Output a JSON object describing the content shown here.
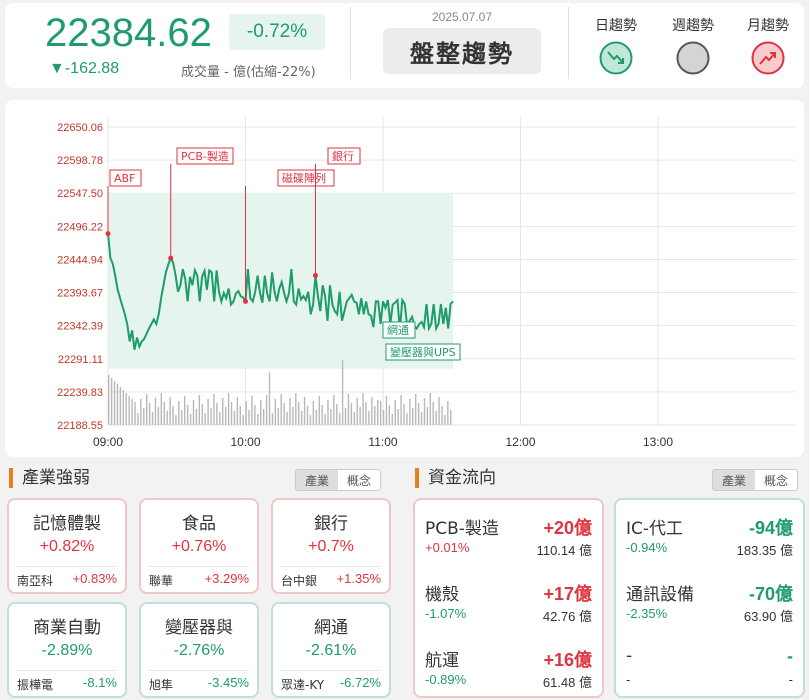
{
  "header": {
    "index_value": "22384.62",
    "change_pct": "-0.72%",
    "change_points": "▼-162.88",
    "volume_text": "成交量 - 億(估縮-22%)",
    "date": "2025.07.07",
    "trend_title": "盤整趨勢",
    "trends": [
      {
        "label": "日趨勢",
        "state": "down",
        "icon": "trend-down-icon"
      },
      {
        "label": "週趨勢",
        "state": "neutral",
        "icon": "neutral-circle-icon"
      },
      {
        "label": "月趨勢",
        "state": "up",
        "icon": "trend-up-icon"
      }
    ]
  },
  "chart_data": {
    "type": "line",
    "y_ticks": [
      "22650.06",
      "22598.78",
      "22547.50",
      "22496.22",
      "22444.94",
      "22393.67",
      "22342.39",
      "22291.11",
      "22239.83",
      "22188.55"
    ],
    "x_ticks": [
      "09:00",
      "10:00",
      "11:00",
      "12:00",
      "13:00"
    ],
    "ylim": [
      22188.55,
      22650.06
    ],
    "prev_close": 22547.5,
    "series": [
      {
        "values": [
          22485,
          22447,
          22438,
          22420,
          22398,
          22385,
          22372,
          22360,
          22344,
          22318,
          22335,
          22305,
          22324,
          22310,
          22318,
          22322,
          22330,
          22338,
          22345,
          22352,
          22345,
          22360,
          22385,
          22405,
          22425,
          22437,
          22447,
          22440,
          22420,
          22395,
          22405,
          22430,
          22415,
          22380,
          22418,
          22405,
          22428,
          22420,
          22380,
          22418,
          22427,
          22398,
          22428,
          22425,
          22380,
          22428,
          22395,
          22380,
          22393,
          22385,
          22400,
          22375,
          22380,
          22392,
          22396,
          22388,
          22386,
          22380,
          22430,
          22385,
          22380,
          22395,
          22420,
          22393,
          22378,
          22420,
          22392,
          22380,
          22425,
          22395,
          22380,
          22400,
          22410,
          22393,
          22380,
          22392,
          22430,
          22380,
          22375,
          22400,
          22383,
          22388,
          22382,
          22395,
          22360,
          22375,
          22420,
          22388,
          22365,
          22405,
          22388,
          22350,
          22405,
          22375,
          22365,
          22360,
          22395,
          22350,
          22365,
          22380,
          22385,
          22390,
          22380,
          22378,
          22360,
          22385,
          22360,
          22380,
          22360,
          22358,
          22340,
          22380,
          22380,
          22345,
          22380,
          22370,
          22382,
          22345,
          22375,
          22378,
          22382,
          22335,
          22382,
          22376,
          22342,
          22350,
          22356,
          22342,
          22338,
          22345,
          22348,
          22340,
          22376,
          22338,
          22345,
          22376,
          22338,
          22345,
          22376,
          22345,
          22370,
          22338,
          22376,
          22380
        ],
        "color": "#1e9c6c"
      }
    ],
    "annotations": [
      {
        "label": "ABF",
        "type": "up"
      },
      {
        "label": "PCB-製造",
        "type": "up"
      },
      {
        "label": "磁碟陣列",
        "type": "up"
      },
      {
        "label": "銀行",
        "type": "up"
      },
      {
        "label": "網通",
        "type": "down"
      },
      {
        "label": "變壓器與UPS",
        "type": "down"
      }
    ]
  },
  "sector_strength": {
    "title": "產業強弱",
    "toggle": [
      "產業",
      "概念"
    ],
    "cards": [
      {
        "name": "記憶體製",
        "pct": "+0.82%",
        "stock": "南亞科",
        "stock_pct": "+0.83%",
        "dir": "up"
      },
      {
        "name": "食品",
        "pct": "+0.76%",
        "stock": "聯華",
        "stock_pct": "+3.29%",
        "dir": "up"
      },
      {
        "name": "銀行",
        "pct": "+0.7%",
        "stock": "台中銀",
        "stock_pct": "+1.35%",
        "dir": "up"
      },
      {
        "name": "商業自動",
        "pct": "-2.89%",
        "stock": "振樺電",
        "stock_pct": "-8.1%",
        "dir": "down"
      },
      {
        "name": "變壓器與",
        "pct": "-2.76%",
        "stock": "旭隼",
        "stock_pct": "-3.45%",
        "dir": "down"
      },
      {
        "name": "網通",
        "pct": "-2.61%",
        "stock": "眾達-KY",
        "stock_pct": "-6.72%",
        "dir": "down"
      }
    ]
  },
  "fund_flow": {
    "title": "資金流向",
    "toggle": [
      "產業",
      "概念"
    ],
    "inflow": [
      {
        "name": "PCB-製造",
        "value": "+20億",
        "pct": "+0.01%",
        "amount": "110.14 億",
        "pct_dir": "up"
      },
      {
        "name": "機殼",
        "value": "+17億",
        "pct": "-1.07%",
        "amount": "42.76 億",
        "pct_dir": "down"
      },
      {
        "name": "航運",
        "value": "+16億",
        "pct": "-0.89%",
        "amount": "61.48 億",
        "pct_dir": "down"
      }
    ],
    "outflow": [
      {
        "name": "IC-代工",
        "value": "-94億",
        "pct": "-0.94%",
        "amount": "183.35 億",
        "pct_dir": "down"
      },
      {
        "name": "通訊設備",
        "value": "-70億",
        "pct": "-2.35%",
        "amount": "63.90 億",
        "pct_dir": "down"
      },
      {
        "name": "-",
        "value": "-",
        "pct": "-",
        "amount": "-",
        "pct_dir": "none"
      }
    ]
  }
}
